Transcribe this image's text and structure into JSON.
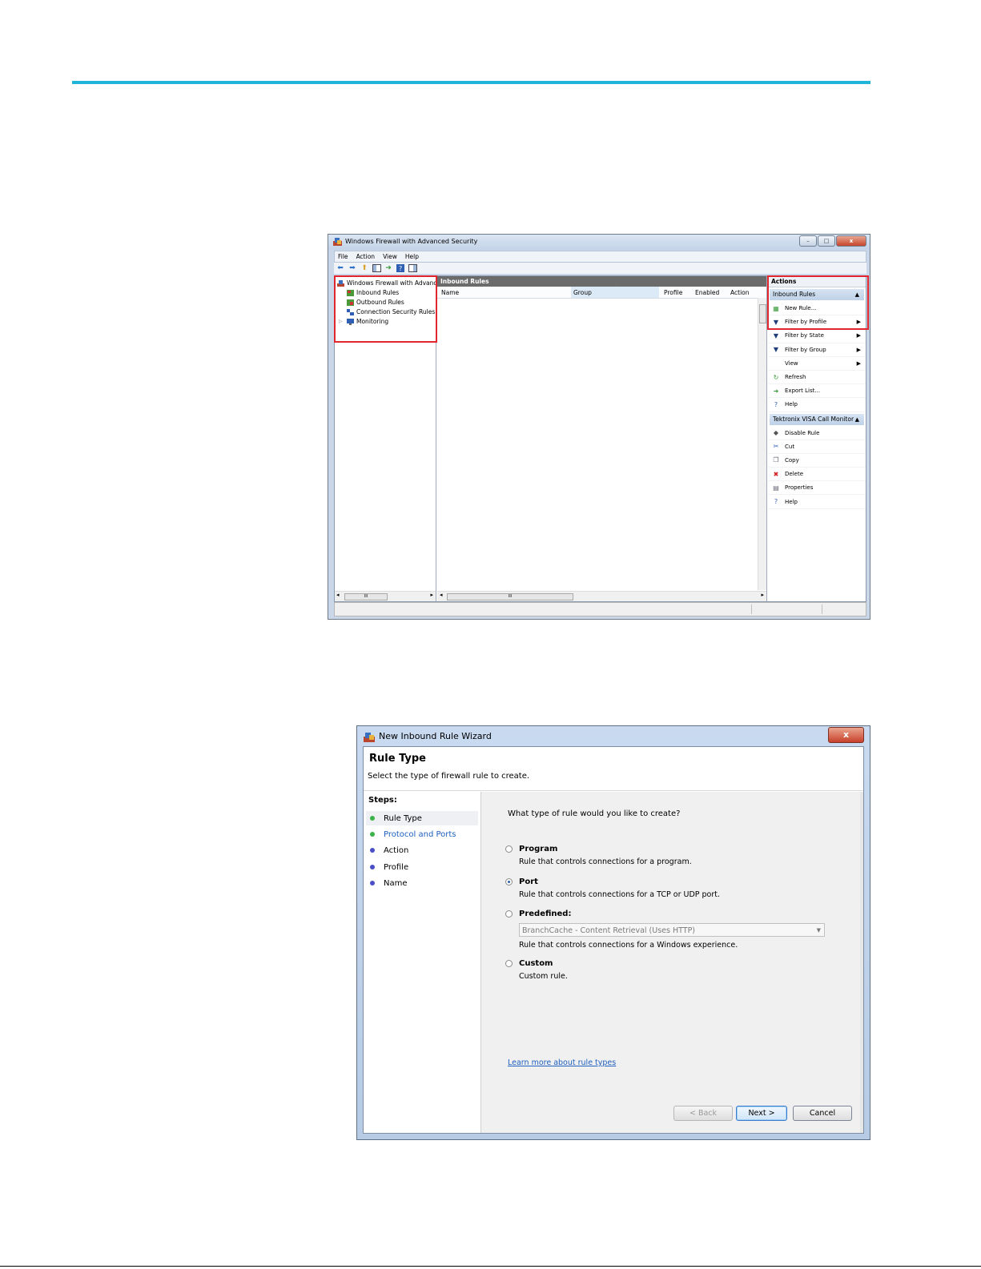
{
  "colors": {
    "accent_rule": "#1fb4d8",
    "highlight": "#e1262d",
    "link": "#1e5fbf"
  },
  "mmc": {
    "title": "Windows Firewall with Advanced Security",
    "caption_min": "–",
    "caption_max": "□",
    "caption_close": "x",
    "menu": [
      "File",
      "Action",
      "View",
      "Help"
    ],
    "tree": {
      "root": "Windows Firewall with Advance",
      "items": [
        "Inbound Rules",
        "Outbound Rules",
        "Connection Security Rules",
        "Monitoring"
      ],
      "expander": "▷",
      "hscroll_thumb": "III"
    },
    "center": {
      "header": "Inbound Rules",
      "columns": [
        "Name",
        "Group",
        "Profile",
        "Enabled",
        "Action"
      ],
      "sort_glyph": "^",
      "hscroll_thumb": "III"
    },
    "actions": {
      "header": "Actions",
      "section1": {
        "title": "Inbound Rules",
        "items": [
          {
            "label": "New Rule...",
            "icon": "new-rule-icon",
            "glyph": "▦",
            "submenu": false
          },
          {
            "label": "Filter by Profile",
            "icon": "filter-icon",
            "glyph": "▼",
            "submenu": true
          },
          {
            "label": "Filter by State",
            "icon": "filter-icon",
            "glyph": "▼",
            "submenu": true
          },
          {
            "label": "Filter by Group",
            "icon": "filter-icon",
            "glyph": "▼",
            "submenu": true
          },
          {
            "label": "View",
            "icon": "none",
            "glyph": "",
            "submenu": true
          },
          {
            "label": "Refresh",
            "icon": "refresh-icon",
            "glyph": "↻",
            "submenu": false
          },
          {
            "label": "Export List...",
            "icon": "export-icon",
            "glyph": "➜",
            "submenu": false
          },
          {
            "label": "Help",
            "icon": "help-icon",
            "glyph": "?",
            "submenu": false
          }
        ]
      },
      "section2": {
        "title": "Tektronix VISA Call Monitor",
        "items": [
          {
            "label": "Disable Rule",
            "icon": "disable-icon",
            "glyph": "◆"
          },
          {
            "label": "Cut",
            "icon": "cut-icon",
            "glyph": "✂"
          },
          {
            "label": "Copy",
            "icon": "copy-icon",
            "glyph": "❐"
          },
          {
            "label": "Delete",
            "icon": "delete-icon",
            "glyph": "✖"
          },
          {
            "label": "Properties",
            "icon": "properties-icon",
            "glyph": "▤"
          },
          {
            "label": "Help",
            "icon": "help-icon",
            "glyph": "?"
          }
        ]
      }
    }
  },
  "wizard": {
    "title": "New Inbound Rule Wizard",
    "close": "x",
    "heading": "Rule Type",
    "subheading": "Select the type of firewall rule to create.",
    "steps_label": "Steps:",
    "steps": [
      "Rule Type",
      "Protocol and Ports",
      "Action",
      "Profile",
      "Name"
    ],
    "question": "What type of rule would you like to create?",
    "options": [
      {
        "label": "Program",
        "desc": "Rule that controls connections for a program.",
        "selected": false
      },
      {
        "label": "Port",
        "desc": "Rule that controls connections for a TCP or UDP port.",
        "selected": true
      },
      {
        "label": "Predefined:",
        "desc": "Rule that controls connections for a Windows experience.",
        "selected": false
      },
      {
        "label": "Custom",
        "desc": "Custom rule.",
        "selected": false
      }
    ],
    "predefined_value": "BranchCache - Content Retrieval (Uses HTTP)",
    "learn_more": "Learn more about rule types",
    "buttons": {
      "back": "< Back",
      "next": "Next >",
      "cancel": "Cancel"
    }
  }
}
